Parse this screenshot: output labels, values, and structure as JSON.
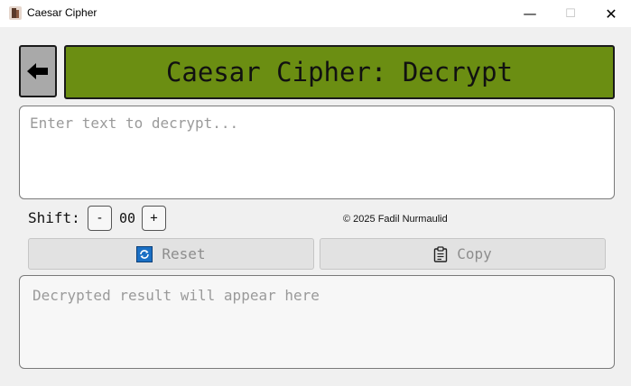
{
  "window": {
    "title": "Caesar Cipher",
    "minimize_glyph": "—",
    "maximize_glyph": "☐",
    "close_glyph": "✕"
  },
  "header": {
    "title": "Caesar Cipher: Decrypt",
    "background": "#6b8e12"
  },
  "input": {
    "value": "",
    "placeholder": "Enter text to decrypt..."
  },
  "shift": {
    "label": "Shift:",
    "minus_label": "-",
    "value": "00",
    "plus_label": "+"
  },
  "footer": {
    "copyright": "© 2025 Fadil Nurmaulid"
  },
  "actions": {
    "reset_label": "Reset",
    "copy_label": "Copy"
  },
  "output": {
    "value": "",
    "placeholder": "Decrypted result will appear here"
  },
  "icons": {
    "app": "app-icon",
    "back": "arrow-left-icon",
    "reset": "refresh-icon",
    "copy": "clipboard-icon"
  }
}
